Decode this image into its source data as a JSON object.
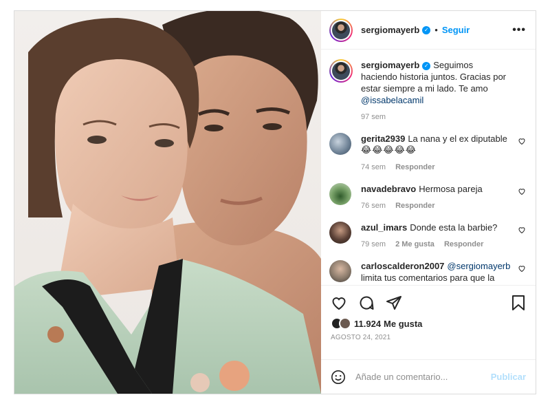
{
  "post": {
    "username": "sergiomayerb",
    "dot": "•",
    "follow_label": "Seguir",
    "more_label": "•••",
    "caption": {
      "username": "sergiomayerb",
      "text": "Seguimos haciendo historia juntos. Gracias por estar siempre a mi lado. Te amo",
      "mention": "@issabelacamil",
      "time": "97 sem"
    },
    "comments": [
      {
        "username": "gerita2939",
        "text": "La nana y el ex diputable",
        "emoji": "😂😂😂😂😂",
        "time": "74 sem",
        "likes": "",
        "reply": "Responder",
        "avatar_color": "#6b7f93"
      },
      {
        "username": "navadebravo",
        "text": "Hermosa pareja",
        "emoji": "",
        "time": "76 sem",
        "likes": "",
        "reply": "Responder",
        "avatar_color": "#4f7a48"
      },
      {
        "username": "azul_imars",
        "text": "Donde esta la barbie?",
        "emoji": "",
        "time": "79 sem",
        "likes": "2 Me gusta",
        "reply": "Responder",
        "avatar_color": "#5a4036"
      },
      {
        "username": "carloscalderon2007",
        "text": "limita tus comentarios para que la",
        "mention": "@sergiomayerb",
        "emoji": "",
        "time": "",
        "likes": "",
        "reply": "",
        "avatar_color": "#8b7b6c"
      }
    ],
    "likes_count": "11.924",
    "likes_label": "Me gusta",
    "date": "AGOSTO 24, 2021",
    "add_comment_placeholder": "Añade un comentario...",
    "publish_label": "Publicar",
    "colors": {
      "accent": "#0095f6",
      "muted": "#8e8e8e",
      "publish_disabled": "#b2dffc"
    }
  }
}
